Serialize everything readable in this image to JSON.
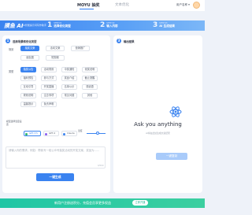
{
  "nav": {
    "tab_active": "MOYU 抽奖",
    "tab_other": "文本优化",
    "user_menu": "用户名称 ▾"
  },
  "banner": {
    "title": "摸鱼 AI",
    "description": "AI智能提示词写作助手",
    "steps": [
      {
        "num": "1",
        "label": "STEP 01",
        "title": "选择优化类型"
      },
      {
        "num": "2",
        "label": "STEP 02",
        "title": "输入内容"
      },
      {
        "num": "3",
        "label": "STEP 03",
        "title": "AI 生成结果"
      }
    ]
  },
  "left_panel": {
    "step_num": "1",
    "title": "选择场景和优化类型",
    "scene_label": "场景",
    "scene_chips": [
      "抽奖文案",
      "活动文案",
      "营销推广",
      "朋友圈",
      "短视频"
    ],
    "type_label": "类型",
    "type_chips": [
      [
        "抽奖公告",
        "活动规则",
        "中奖通知",
        "领奖说明"
      ],
      [
        "福利预告",
        "参与方式",
        "奖品介绍",
        "截止提醒"
      ],
      [
        "互动引导",
        "开奖直播",
        "名单公示",
        "感谢语"
      ],
      [
        "规则说明",
        "注意事项",
        "常见问题",
        "其他"
      ],
      [
        "温馨提示",
        "免责声明"
      ]
    ],
    "model_label": "模型选择温度设置",
    "models": [
      {
        "name": "GPT-3.5",
        "dot": "green"
      },
      {
        "name": "GPT-4",
        "dot": "purple"
      },
      {
        "name": "Claude",
        "dot": "blue"
      }
    ],
    "temp_label": "温度",
    "temperature": 0.7,
    "input_placeholder": "请输入你的需求，例如：帮我写一段公众号抽奖活动的开奖文案，奖品为……",
    "counter": "0/500",
    "generate_label": "一键生成"
  },
  "right_panel": {
    "step_num": "3",
    "title": "输出结果",
    "heading": "Ask you anything",
    "subtitle": "AI将在此处生成文案结果",
    "copy_label": "一键复制"
  },
  "footer": {
    "text": "新用户注册送积分，充值会员享更多权益",
    "button": "立即开通"
  },
  "colors": {
    "accent": "#3a83f0",
    "footer": "#1fc6a5"
  }
}
